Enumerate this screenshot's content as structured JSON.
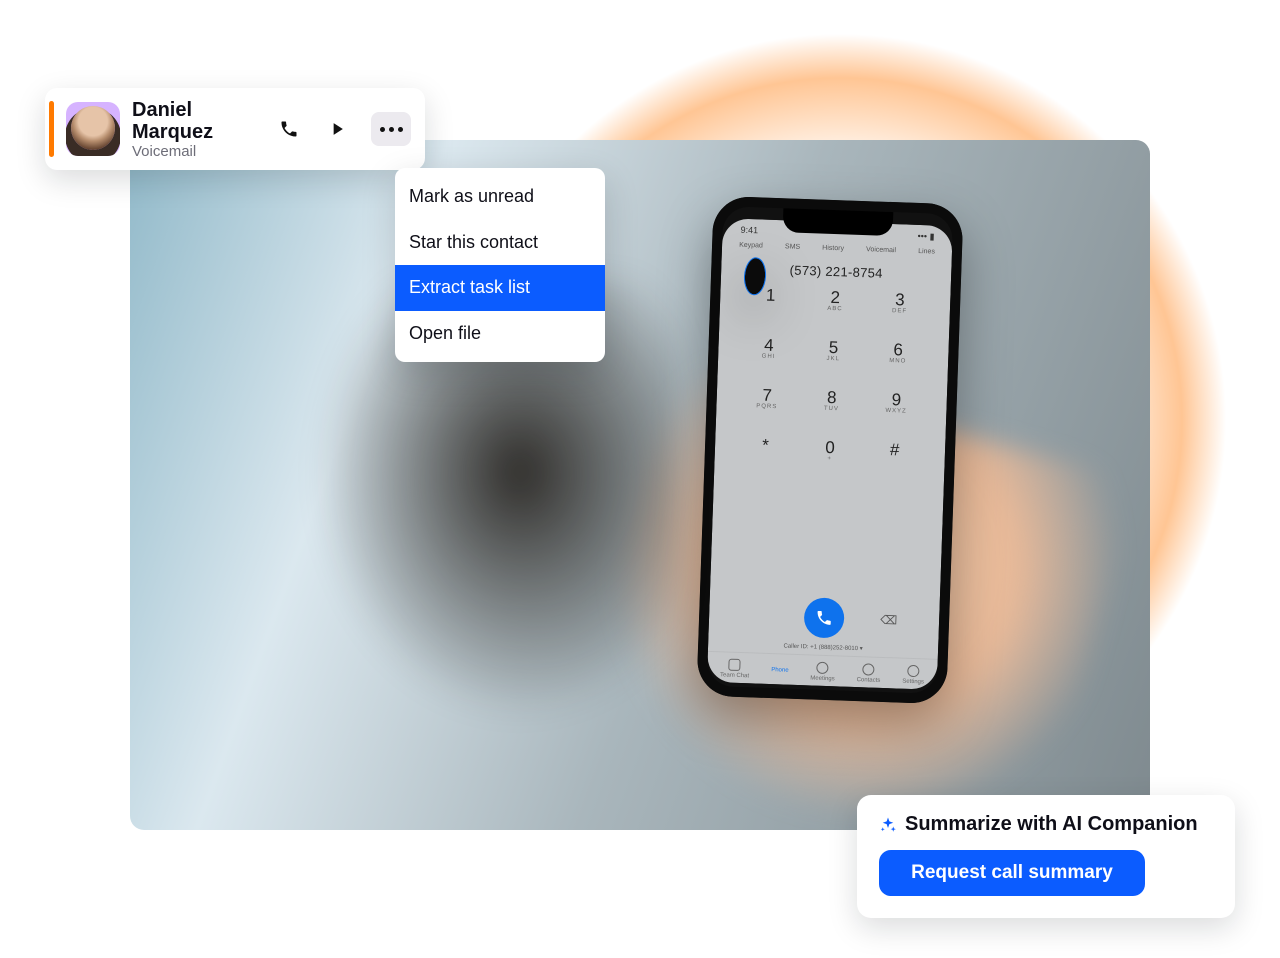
{
  "voicemail_card": {
    "name": "Daniel Marquez",
    "subtitle": "Voicemail"
  },
  "context_menu": {
    "items": [
      {
        "label": "Mark as unread",
        "active": false
      },
      {
        "label": "Star this contact",
        "active": false
      },
      {
        "label": "Extract task list",
        "active": true
      },
      {
        "label": "Open file",
        "active": false
      }
    ]
  },
  "phone": {
    "status_time": "9:41",
    "top_tabs": [
      "Keypad",
      "SMS",
      "History",
      "Voicemail",
      "Lines"
    ],
    "number": "(573) 221-8754",
    "keypad": [
      {
        "n": "1",
        "s": ""
      },
      {
        "n": "2",
        "s": "ABC"
      },
      {
        "n": "3",
        "s": "DEF"
      },
      {
        "n": "4",
        "s": "GHI"
      },
      {
        "n": "5",
        "s": "JKL"
      },
      {
        "n": "6",
        "s": "MNO"
      },
      {
        "n": "7",
        "s": "PQRS"
      },
      {
        "n": "8",
        "s": "TUV"
      },
      {
        "n": "9",
        "s": "WXYZ"
      },
      {
        "n": "*",
        "s": ""
      },
      {
        "n": "0",
        "s": "+"
      },
      {
        "n": "#",
        "s": ""
      }
    ],
    "caller_id": "Caller ID: +1 (888)252-8010 ▾",
    "bottom_tabs": [
      "Team Chat",
      "Phone",
      "Meetings",
      "Contacts",
      "Settings"
    ]
  },
  "ai_card": {
    "title": "Summarize with AI Companion",
    "button": "Request call summary"
  }
}
